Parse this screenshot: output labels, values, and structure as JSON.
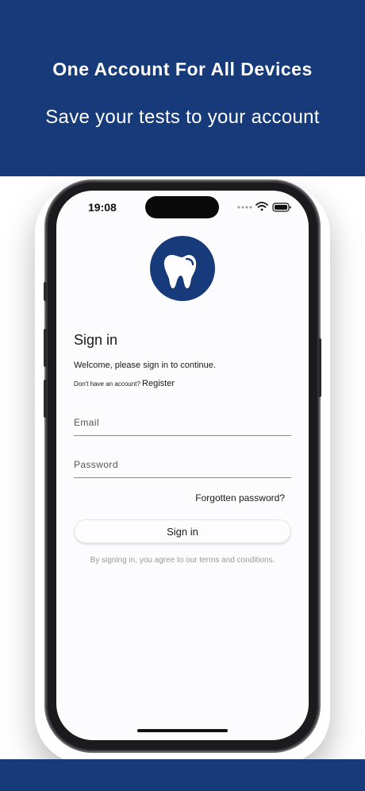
{
  "banner": {
    "headline": "One Account For All Devices",
    "subheadline": "Save your tests to your account"
  },
  "status_bar": {
    "time": "19:08",
    "icons": [
      "dots-icon",
      "wifi-icon",
      "battery-icon"
    ]
  },
  "app": {
    "logo_icon": "tooth-icon",
    "title": "Sign in",
    "welcome_text": "Welcome, please sign in to continue.",
    "no_account_text": "Don't have an account?",
    "register_link": "Register",
    "email_placeholder": "Email",
    "password_placeholder": "Password",
    "forgot_link": "Forgotten password?",
    "signin_button": "Sign in",
    "terms_text": "By signing in, you agree to our terms and conditions."
  },
  "colors": {
    "brand_blue": "#173a7a",
    "screen_bg": "#fcfbfe"
  }
}
